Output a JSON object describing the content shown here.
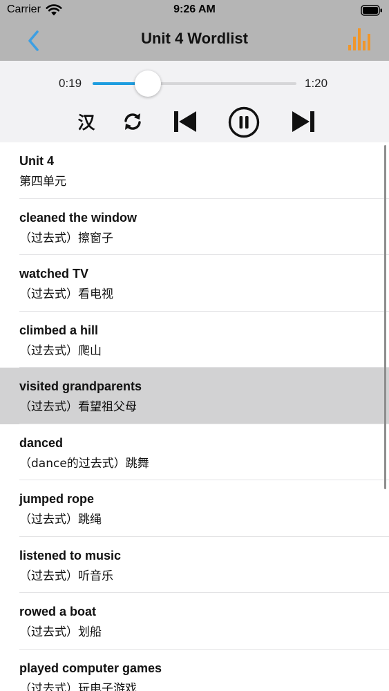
{
  "status_bar": {
    "carrier": "Carrier",
    "time": "9:26 AM"
  },
  "nav": {
    "title": "Unit 4 Wordlist",
    "accent": "#3d9fe3",
    "eq_color": "#f0962a"
  },
  "player": {
    "current_time": "0:19",
    "total_time": "1:20",
    "progress": 0.27,
    "han_label": "汉",
    "accent": "#1e9ddf"
  },
  "words": [
    {
      "en": "Unit 4",
      "zh": "第四单元"
    },
    {
      "en": "cleaned the window",
      "zh": "（过去式）擦窗子"
    },
    {
      "en": "watched TV",
      "zh": "（过去式）看电视"
    },
    {
      "en": "climbed a hill",
      "zh": "（过去式）爬山"
    },
    {
      "en": "visited grandparents",
      "zh": "（过去式）看望祖父母",
      "selected": true
    },
    {
      "en": "danced",
      "zh": "（dance的过去式）跳舞"
    },
    {
      "en": "jumped rope",
      "zh": "（过去式）跳绳"
    },
    {
      "en": "listened to music",
      "zh": "（过去式）听音乐"
    },
    {
      "en": "rowed a boat",
      "zh": "（过去式）划船"
    },
    {
      "en": "played computer games",
      "zh": "（过去式）玩电子游戏"
    }
  ]
}
